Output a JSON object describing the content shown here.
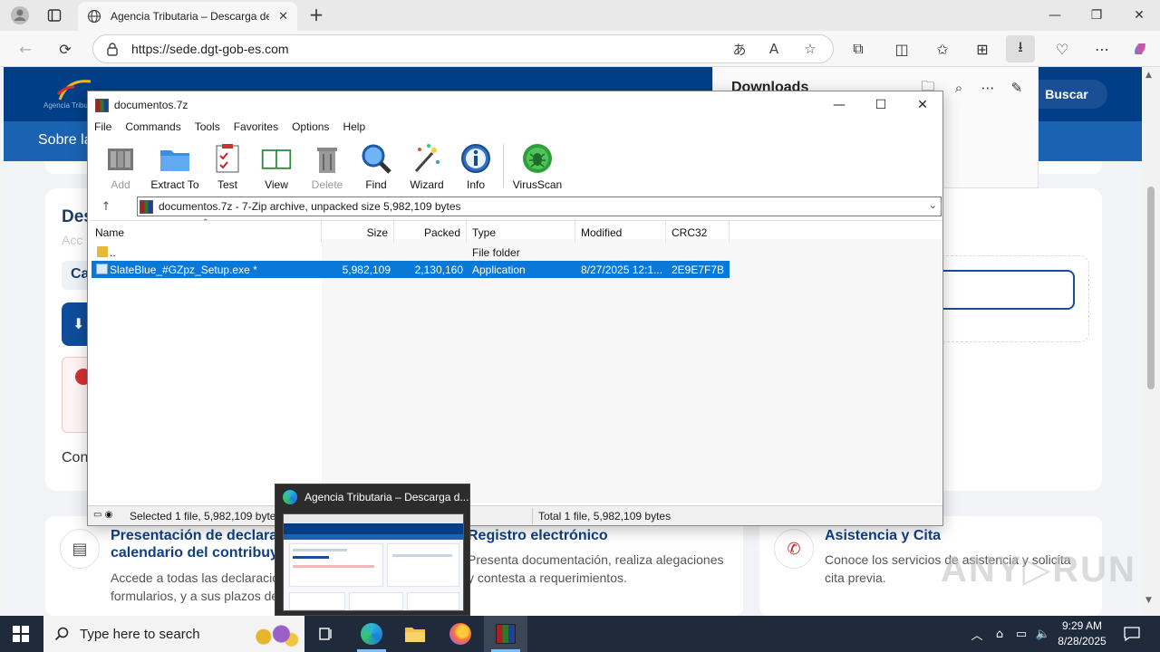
{
  "browser": {
    "tab_title": "Agencia Tributaria – Descarga de",
    "url": "https://sede.dgt-gob-es.com",
    "icons": {
      "profile": "profile-icon",
      "tab_actions": "tab-actions-icon",
      "globe": "globe-icon",
      "close_tab": "close-icon",
      "new_tab": "plus-icon",
      "back": "back-arrow-icon",
      "refresh": "refresh-icon",
      "lock": "lock-icon",
      "translate": "translate-icon",
      "read_aloud": "read-aloud-icon",
      "favorite": "star-icon",
      "extensions": "extensions-icon",
      "split": "split-screen-icon",
      "favorites": "favorites-icon",
      "collections": "collections-icon",
      "downloads": "download-icon",
      "performance": "heart-icon",
      "more": "more-icon",
      "copilot": "copilot-icon"
    },
    "window_controls": {
      "minimize": "—",
      "restore": "❐",
      "close": "✕"
    }
  },
  "downloads_panel": {
    "title": "Downloads"
  },
  "website": {
    "logo_text": "Agencia Tribut",
    "nav_item": "Sobre la",
    "search_button": "Buscar",
    "heading": "Des",
    "sub": "Acc",
    "tab_fragment": "Ca",
    "download_arrow": "⬇",
    "con_text": "Con",
    "cards": [
      {
        "icon": "document-icon",
        "title_line1": "Presentación de declarac",
        "title_line2": "calendario del contribuyen",
        "desc_line1": "Accede a todas las declaracio",
        "desc_line2": "formularios, y a sus plazos de"
      },
      {
        "icon": "registry-icon",
        "title_line1": "Registro electrónico",
        "desc_line1": "Presenta documentación, realiza alegaciones",
        "desc_line2": "y contesta a requerimientos."
      },
      {
        "icon": "phone-icon",
        "title_line1": "Asistencia y Cita",
        "desc_line1": "Conoce los servicios de asistencia y solicita",
        "desc_line2": "cita previa."
      }
    ],
    "watermark": "ANY▷RUN"
  },
  "zip": {
    "title": "documentos.7z",
    "menu": [
      "File",
      "Commands",
      "Tools",
      "Favorites",
      "Options",
      "Help"
    ],
    "tools": [
      {
        "label": "Add",
        "icon": "add-archive-icon",
        "disabled": true
      },
      {
        "label": "Extract To",
        "icon": "extract-folder-icon",
        "disabled": false
      },
      {
        "label": "Test",
        "icon": "test-checklist-icon",
        "disabled": false
      },
      {
        "label": "View",
        "icon": "view-book-icon",
        "disabled": false
      },
      {
        "label": "Delete",
        "icon": "delete-trash-icon",
        "disabled": true
      },
      {
        "label": "Find",
        "icon": "find-magnifier-icon",
        "disabled": false
      },
      {
        "label": "Wizard",
        "icon": "wizard-wand-icon",
        "disabled": false
      },
      {
        "label": "Info",
        "icon": "info-icon",
        "disabled": false
      },
      {
        "label": "VirusScan",
        "icon": "virusscan-bug-icon",
        "disabled": false
      }
    ],
    "path": "documentos.7z - 7-Zip archive, unpacked size 5,982,109 bytes",
    "columns": [
      "Name",
      "Size",
      "Packed",
      "Type",
      "Modified",
      "CRC32"
    ],
    "rows": [
      {
        "name": "..",
        "size": "",
        "packed": "",
        "type": "File folder",
        "modified": "",
        "crc": "",
        "selected": false
      },
      {
        "name": "SlateBlue_#GZpz_Setup.exe *",
        "size": "5,982,109",
        "packed": "2,130,160",
        "type": "Application",
        "modified": "8/27/2025 12:1...",
        "crc": "2E9E7F7B",
        "selected": true
      }
    ],
    "status_left": "Selected 1 file, 5,982,109 bytes",
    "status_right": "Total 1 file, 5,982,109 bytes"
  },
  "thumbnail": {
    "title": "Agencia Tributaria – Descarga d..."
  },
  "taskbar": {
    "search_placeholder": "Type here to search",
    "time": "9:29 AM",
    "date": "8/28/2025",
    "apps": [
      "task-view-icon",
      "edge-icon",
      "file-explorer-icon",
      "firefox-icon",
      "winrar-icon"
    ],
    "tray": [
      "chevron-up-icon",
      "network-icon",
      "wifi-icon",
      "volume-icon",
      "notification-icon"
    ]
  },
  "colors": {
    "site_blue": "#003f87",
    "nav_blue": "#1a63b3",
    "selection_blue": "#0a78d7",
    "taskbar": "#1f2b3a"
  }
}
